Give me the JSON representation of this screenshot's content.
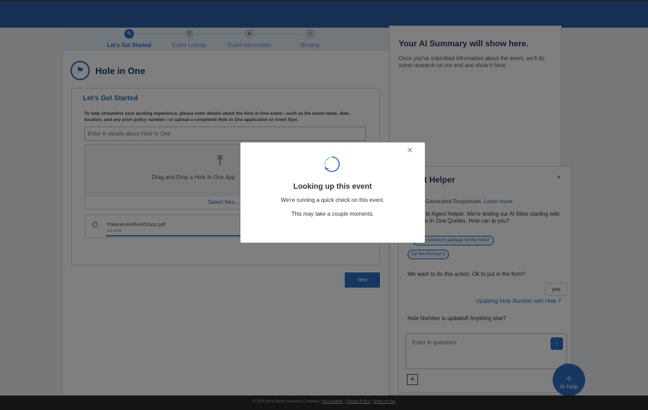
{
  "stepper": {
    "steps": [
      {
        "label": "Let's Get Started",
        "icon": "pencil-icon"
      },
      {
        "label": "Event Lookup",
        "icon": "golfer-icon"
      },
      {
        "label": "Event Information",
        "icon": "person-icon"
      },
      {
        "label": "Binding",
        "icon": "check-icon"
      }
    ]
  },
  "page": {
    "title": "Hole in One",
    "title_icon": "golf-flag-icon"
  },
  "form": {
    "heading": "Let's Get Started",
    "description": "To help streamline your quoting experience, please enter details about the Hole in One event—such as the event name, date, location, and any prior policy number—or upload a completed Hole in One application or event flyer.",
    "input_placeholder": "Enter in details about Hole In One",
    "drop_text": "Drag and Drop a Hole In One App",
    "select_files": "Select files...",
    "file": {
      "name": "PalantineHillsHIOApp.pdf",
      "size": "223.48 KB"
    },
    "next_label": "Next"
  },
  "summary": {
    "title": "Your AI Summary will show here.",
    "text": "Once you've submitted information about the event, we'll do some research on our end and show it here."
  },
  "helper": {
    "title": "t Helper",
    "close": "×",
    "generated": "Generated Responses.",
    "learn_more": "Learn more.",
    "welcome": "me to Agent Helper. We're testing our AI ilities starting with Hole In One Quotes. How can lp you?",
    "chips": [
      "s the minimum yardage for the hole?",
      "Do the first par 3"
    ],
    "action_prompt": "We want to do this action. Ok to put in the form?",
    "yes_label": "yes",
    "updating": "Updating Hole Number with Hole 7",
    "updated": "Hole Number is updated! Anything else?",
    "question_placeholder": "Enter in questions",
    "send_icon": "↑",
    "plus_icon": "+"
  },
  "ai_help": {
    "label": "AI Help",
    "icon": "sparkle-icon"
  },
  "footer": {
    "copyright": "© 2025 West Bend Insurance Company |",
    "accessibility": "Accessibility",
    "sep1": "|",
    "privacy": "Privacy Policy",
    "sep2": "|",
    "terms": "Terms of Use"
  },
  "modal": {
    "title": "Looking up this event",
    "subtitle": "We're running a quick check on this event.",
    "note": "This may take a couple moments.",
    "close": "×"
  },
  "colors": {
    "brand_blue": "#2d6fc4",
    "topbar": "#2d5ea6",
    "footer": "#2a2a2a"
  }
}
